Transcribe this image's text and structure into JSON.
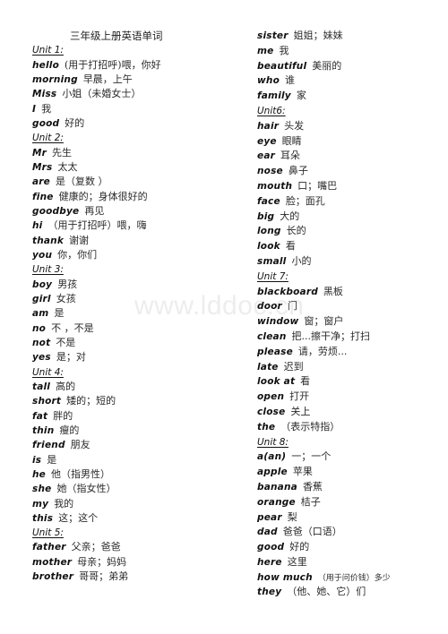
{
  "title": "三年级上册英语单词",
  "watermark": "www.lddoc.cn",
  "left_column": [
    {
      "type": "unit",
      "label": "Unit 1:"
    },
    {
      "type": "word",
      "en": "hello",
      "zh": "(用于打招呼)喂，你好"
    },
    {
      "type": "word",
      "en": "morning",
      "zh": "早晨，上午"
    },
    {
      "type": "word",
      "en": "Miss",
      "zh": "小姐（未婚女士）"
    },
    {
      "type": "word",
      "en": "I",
      "zh": "我"
    },
    {
      "type": "word",
      "en": "good",
      "zh": "好的"
    },
    {
      "type": "unit",
      "label": "Unit 2:"
    },
    {
      "type": "word",
      "en": "Mr",
      "zh": "先生"
    },
    {
      "type": "word",
      "en": "Mrs",
      "zh": "太太"
    },
    {
      "type": "word",
      "en": "are",
      "zh": "是（复数 ）"
    },
    {
      "type": "word",
      "en": "fine",
      "zh": "健康的；身体很好的"
    },
    {
      "type": "word",
      "en": "goodbye",
      "zh": "再见"
    },
    {
      "type": "word",
      "en": "hi",
      "zh": "（用于打招呼）喂，嗨"
    },
    {
      "type": "word",
      "en": "thank",
      "zh": "谢谢"
    },
    {
      "type": "word",
      "en": "you",
      "zh": "你，你们"
    },
    {
      "type": "unit",
      "label": "Unit 3:"
    },
    {
      "type": "word",
      "en": "boy",
      "zh": "男孩"
    },
    {
      "type": "word",
      "en": "girl",
      "zh": "女孩"
    },
    {
      "type": "word",
      "en": "am",
      "zh": "是"
    },
    {
      "type": "word",
      "en": "no",
      "zh": "不 ，不是"
    },
    {
      "type": "word",
      "en": "not",
      "zh": "不是"
    },
    {
      "type": "word",
      "en": "yes",
      "zh": "是；对"
    },
    {
      "type": "unit",
      "label": "Unit 4:"
    },
    {
      "type": "word",
      "en": "tall",
      "zh": "高的"
    },
    {
      "type": "word",
      "en": "short",
      "zh": "矮的；短的"
    },
    {
      "type": "word",
      "en": "fat",
      "zh": "胖的"
    },
    {
      "type": "word",
      "en": "thin",
      "zh": "瘦的"
    },
    {
      "type": "word",
      "en": "friend",
      "zh": "朋友"
    },
    {
      "type": "word",
      "en": "is",
      "zh": "是"
    },
    {
      "type": "word",
      "en": "he",
      "zh": "他（指男性）"
    },
    {
      "type": "word",
      "en": "she",
      "zh": "她（指女性）"
    },
    {
      "type": "word",
      "en": "my",
      "zh": "我的"
    },
    {
      "type": "word",
      "en": "this",
      "zh": "这；这个"
    },
    {
      "type": "unit",
      "label": "Unit 5:"
    },
    {
      "type": "word",
      "en": "father",
      "zh": "父亲；爸爸"
    },
    {
      "type": "word",
      "en": "mother",
      "zh": "母亲；妈妈"
    },
    {
      "type": "word",
      "en": "brother",
      "zh": "哥哥；弟弟"
    }
  ],
  "right_column": [
    {
      "type": "word",
      "en": "sister",
      "zh": "姐姐；妹妹"
    },
    {
      "type": "word",
      "en": "me",
      "zh": "我"
    },
    {
      "type": "word",
      "en": "beautiful",
      "zh": "美丽的"
    },
    {
      "type": "word",
      "en": "who",
      "zh": "谁"
    },
    {
      "type": "word",
      "en": "family",
      "zh": "家"
    },
    {
      "type": "unit",
      "label": "Unit6:"
    },
    {
      "type": "word",
      "en": "hair",
      "zh": "头发"
    },
    {
      "type": "word",
      "en": "eye",
      "zh": "眼睛"
    },
    {
      "type": "word",
      "en": "ear",
      "zh": "耳朵"
    },
    {
      "type": "word",
      "en": "nose",
      "zh": "鼻子"
    },
    {
      "type": "word",
      "en": "mouth",
      "zh": "口；嘴巴"
    },
    {
      "type": "word",
      "en": "face",
      "zh": "脸；面孔"
    },
    {
      "type": "word",
      "en": "big",
      "zh": "大的"
    },
    {
      "type": "word",
      "en": "long",
      "zh": "长的"
    },
    {
      "type": "word",
      "en": "look",
      "zh": "看"
    },
    {
      "type": "word",
      "en": "small",
      "zh": "小的"
    },
    {
      "type": "unit",
      "label": "Unit 7:"
    },
    {
      "type": "word",
      "en": "blackboard",
      "zh": "黑板"
    },
    {
      "type": "word",
      "en": "door",
      "zh": "门"
    },
    {
      "type": "word",
      "en": "window",
      "zh": "窗；窗户"
    },
    {
      "type": "word",
      "en": "clean",
      "zh": "把...擦干净；打扫"
    },
    {
      "type": "word",
      "en": "please",
      "zh": "请，劳烦..."
    },
    {
      "type": "word",
      "en": "late",
      "zh": "迟到"
    },
    {
      "type": "word",
      "en": "look at",
      "zh": "看"
    },
    {
      "type": "word",
      "en": "open",
      "zh": "打开"
    },
    {
      "type": "word",
      "en": "close",
      "zh": "关上"
    },
    {
      "type": "word",
      "en": "the",
      "zh": "（表示特指）"
    },
    {
      "type": "unit",
      "label": "Unit 8:"
    },
    {
      "type": "word",
      "en": "a(an)",
      "zh": "一；一个"
    },
    {
      "type": "word",
      "en": "apple",
      "zh": "苹果"
    },
    {
      "type": "word",
      "en": "banana",
      "zh": "香蕉"
    },
    {
      "type": "word",
      "en": "orange",
      "zh": "桔子"
    },
    {
      "type": "word",
      "en": "pear",
      "zh": "梨"
    },
    {
      "type": "word",
      "en": "dad",
      "zh": "爸爸（口语）"
    },
    {
      "type": "word",
      "en": "good",
      "zh": "好的"
    },
    {
      "type": "word",
      "en": "here",
      "zh": "这里"
    },
    {
      "type": "word",
      "en": "how much",
      "zh": "（用于问价钱）多少",
      "small": true
    },
    {
      "type": "word",
      "en": "they",
      "zh": "（他、她、它）们"
    }
  ]
}
